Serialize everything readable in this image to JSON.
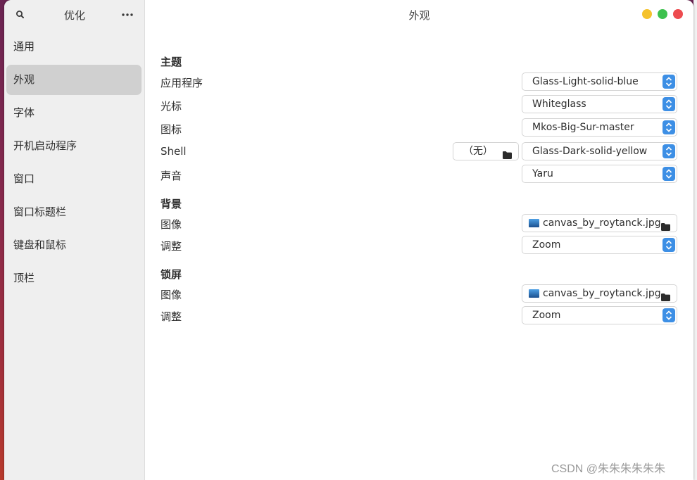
{
  "colors": {
    "accent": "#3d8fe5",
    "minimize": "#f5c22c",
    "maximize": "#3dc14e",
    "close": "#ed4b4f",
    "sidebar_active": "#d0d0d0"
  },
  "sidebar": {
    "title": "优化",
    "search_icon": "search-icon",
    "menu_icon": "more-horizontal-icon",
    "items": [
      {
        "label": "通用",
        "active": false
      },
      {
        "label": "外观",
        "active": true
      },
      {
        "label": "字体",
        "active": false
      },
      {
        "label": "开机启动程序",
        "active": false
      },
      {
        "label": "窗口",
        "active": false
      },
      {
        "label": "窗口标题栏",
        "active": false
      },
      {
        "label": "键盘和鼠标",
        "active": false
      },
      {
        "label": "顶栏",
        "active": false
      }
    ]
  },
  "main": {
    "title": "外观",
    "theme": {
      "heading": "主题",
      "app_label": "应用程序",
      "app_value": "Glass-Light-solid-blue",
      "cursor_label": "光标",
      "cursor_value": "Whiteglass",
      "icon_label": "图标",
      "icon_value": "Mkos-Big-Sur-master",
      "shell_label": "Shell",
      "shell_none": "（无）",
      "shell_value": "Glass-Dark-solid-yellow",
      "sound_label": "声音",
      "sound_value": "Yaru"
    },
    "background": {
      "heading": "背景",
      "image_label": "图像",
      "image_value": "canvas_by_roytanck.jpg",
      "adjust_label": "调整",
      "adjust_value": "Zoom"
    },
    "lockscreen": {
      "heading": "锁屏",
      "image_label": "图像",
      "image_value": "canvas_by_roytanck.jpg",
      "adjust_label": "调整",
      "adjust_value": "Zoom"
    }
  },
  "watermark": "CSDN @朱朱朱朱朱朱"
}
